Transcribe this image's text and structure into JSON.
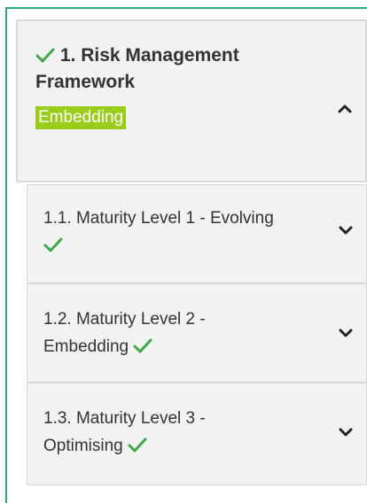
{
  "section": {
    "number_title": "1. Risk Management Framework",
    "title_line1": "1. Risk Management",
    "title_line2": "Framework",
    "status_badge": "Embedding",
    "expanded": true
  },
  "subsections": [
    {
      "line1": "1.1. Maturity Level 1 - Evolving",
      "line2": "",
      "completed": true
    },
    {
      "line1": "1.2. Maturity Level 2 -",
      "line2": "Embedding",
      "completed": true
    },
    {
      "line1": "1.3. Maturity Level 3 -",
      "line2": "Optimising",
      "completed": true
    }
  ],
  "colors": {
    "accent_green": "#2eaa78",
    "check_green": "#3aaa46",
    "badge_bg": "#9acd1a",
    "panel_bg": "#f2f2f2"
  },
  "icons": {
    "check": "checkmark-icon",
    "collapse": "chevron-up-icon",
    "expand": "chevron-down-icon"
  }
}
